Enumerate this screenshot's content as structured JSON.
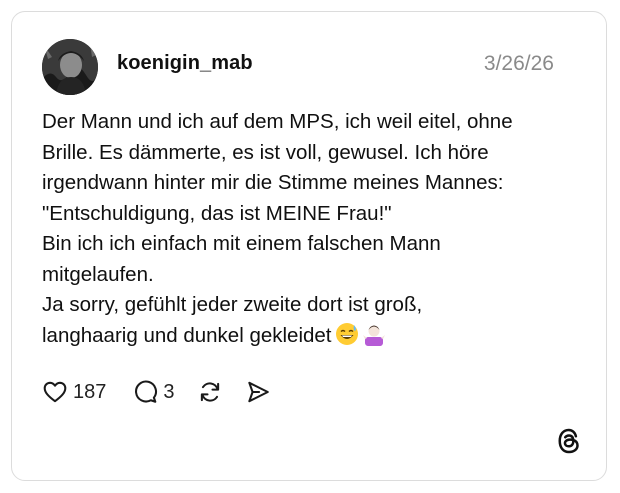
{
  "post": {
    "username": "koenigin_mab",
    "date": "3/26/26",
    "lines": [
      "Der Mann und ich auf dem MPS, ich weil eitel, ohne",
      "Brille. Es dämmerte, es ist voll, gewusel. Ich höre",
      "irgendwann hinter mir die Stimme meines Mannes:",
      "\"Entschuldigung, das ist MEINE Frau!\"",
      "Bin ich ich einfach mit einem falschen Mann",
      "mitgelaufen.",
      "Ja sorry, gefühlt jeder zweite dort ist groß,",
      "langhaarig und dunkel gekleidet"
    ],
    "emojis": [
      "grinning-face-with-sweat",
      "person-shrugging"
    ]
  },
  "actions": {
    "likes": "187",
    "replies": "3",
    "icons": [
      "heart-icon",
      "comment-icon",
      "repost-icon",
      "share-icon"
    ]
  },
  "brand": {
    "logo": "threads-logo-icon"
  },
  "colors": {
    "text": "#101010",
    "muted": "#8a8a8a",
    "border": "#dcdcdc"
  }
}
